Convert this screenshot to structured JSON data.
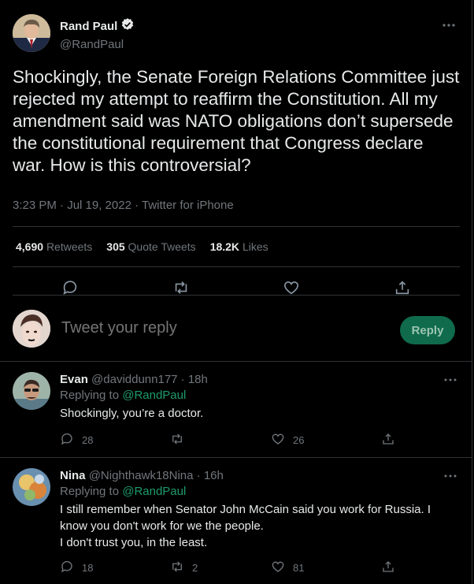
{
  "main_tweet": {
    "author_name": "Rand Paul",
    "author_handle": "@RandPaul",
    "text": "Shockingly, the Senate Foreign Relations Committee just rejected my attempt to reaffirm the Constitution. All my amendment said was NATO obligations don’t supersede the constitutional requirement that Congress declare war. How is this controversial?",
    "timestamp": "3:23 PM · Jul 19, 2022 · Twitter for iPhone",
    "retweets_count": "4,690",
    "retweets_label": "Retweets",
    "quotes_count": "305",
    "quotes_label": "Quote Tweets",
    "likes_count": "18.2K",
    "likes_label": "Likes"
  },
  "composer": {
    "placeholder": "Tweet your reply",
    "button_label": "Reply"
  },
  "replies": [
    {
      "name": "Evan",
      "handle_time": "@daviddunn177 · 18h",
      "replying_prefix": "Replying to ",
      "replying_to": "@RandPaul",
      "text": "Shockingly, you’re a doctor.",
      "replies_count": "28",
      "retweets_count": "",
      "likes_count": "26"
    },
    {
      "name": "Nina",
      "handle_time": "@Nighthawk18Nina · 16h",
      "replying_prefix": "Replying to ",
      "replying_to": "@RandPaul",
      "text_lines": [
        "I still remember when Senator John McCain said you work for Russia. I",
        "know you don't work for we the people.",
        "I don't trust you, in the least."
      ],
      "replies_count": "18",
      "retweets_count": "2",
      "likes_count": "81"
    }
  ],
  "colors": {
    "background": "#000000",
    "text": "#e7e9ea",
    "muted": "#71767b",
    "accent": "#1d9b6c",
    "reply_button": "#0f6b4c",
    "divider": "#2f3336"
  }
}
